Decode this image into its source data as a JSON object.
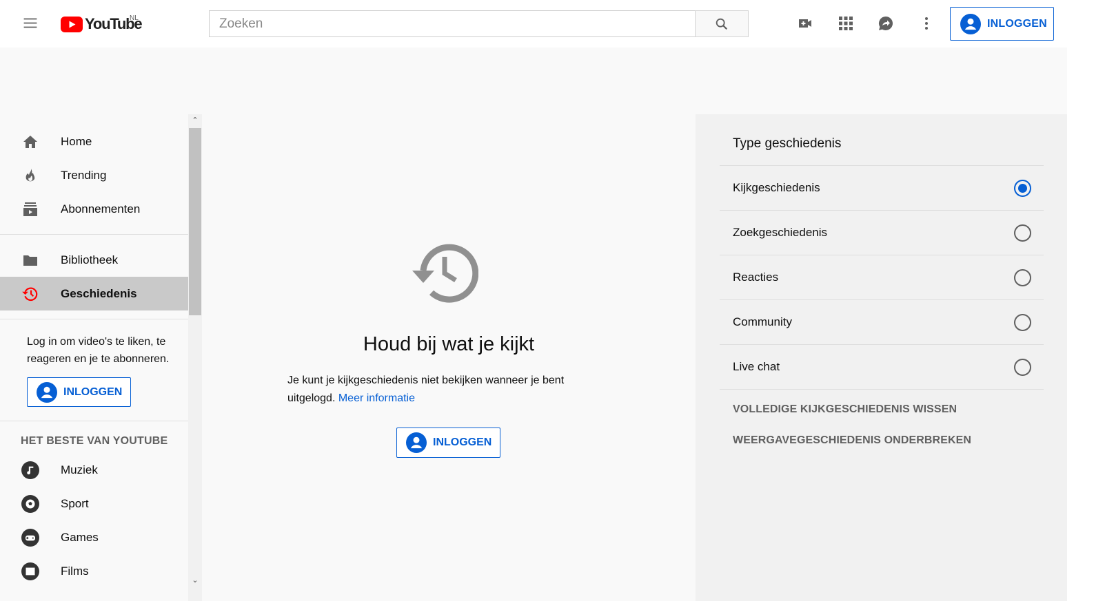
{
  "header": {
    "logo_text": "YouTube",
    "region": "NL",
    "search_placeholder": "Zoeken",
    "signin_label": "INLOGGEN",
    "icons": [
      "menu-icon",
      "search-icon",
      "create-video-icon",
      "apps-icon",
      "messages-icon",
      "more-vert-icon",
      "account-icon"
    ]
  },
  "sidebar": {
    "items": [
      {
        "label": "Home",
        "icon": "home-icon"
      },
      {
        "label": "Trending",
        "icon": "trending-icon"
      },
      {
        "label": "Abonnementen",
        "icon": "subscriptions-icon"
      }
    ],
    "items2": [
      {
        "label": "Bibliotheek",
        "icon": "library-icon"
      },
      {
        "label": "Geschiedenis",
        "icon": "history-icon",
        "active": true
      }
    ],
    "signin_text": "Log in om video's te liken, te reageren en je te abonneren.",
    "signin_label": "INLOGGEN",
    "section_title": "HET BESTE VAN YOUTUBE",
    "best": [
      {
        "label": "Muziek",
        "icon": "music-icon"
      },
      {
        "label": "Sport",
        "icon": "sport-icon"
      },
      {
        "label": "Games",
        "icon": "games-icon"
      },
      {
        "label": "Films",
        "icon": "films-icon"
      }
    ]
  },
  "main": {
    "title": "Houd bij wat je kijkt",
    "description": "Je kunt je kijkgeschiedenis niet bekijken wanneer je bent uitgelogd.",
    "link": "Meer informatie",
    "signin_label": "INLOGGEN"
  },
  "history_panel": {
    "title": "Type geschiedenis",
    "options": [
      {
        "label": "Kijkgeschiedenis",
        "selected": true
      },
      {
        "label": "Zoekgeschiedenis",
        "selected": false
      },
      {
        "label": "Reacties",
        "selected": false
      },
      {
        "label": "Community",
        "selected": false
      },
      {
        "label": "Live chat",
        "selected": false
      }
    ],
    "clear_label": "VOLLEDIGE KIJKGESCHIEDENIS WISSEN",
    "pause_label": "WEERGAVEGESCHIEDENIS ONDERBREKEN"
  },
  "colors": {
    "accent": "#065fd4",
    "brand_red": "#ff0000",
    "text": "#0f0f0f",
    "secondary": "#606060"
  }
}
